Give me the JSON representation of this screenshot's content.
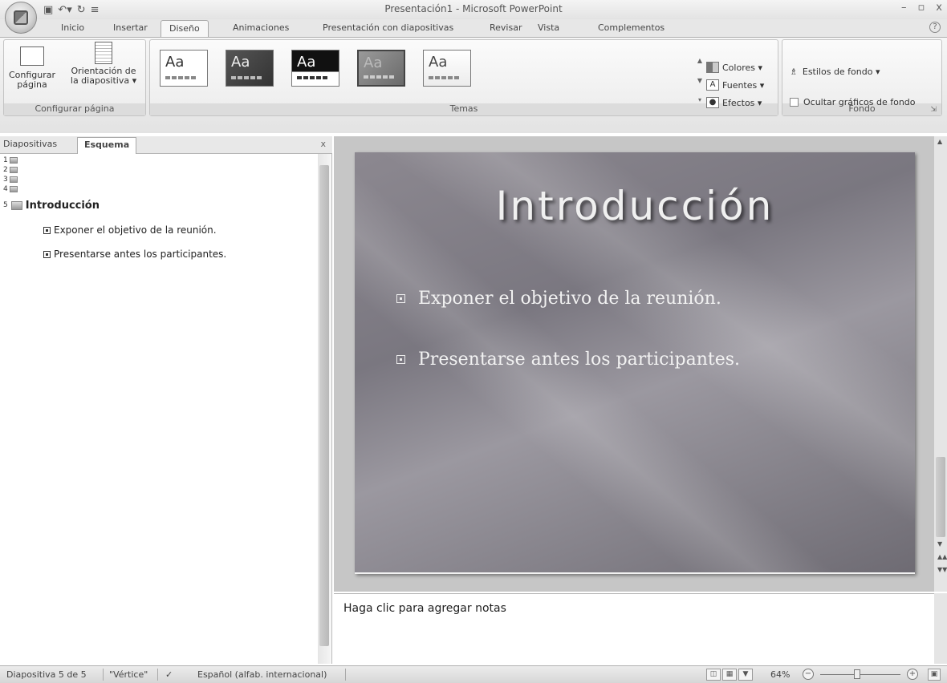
{
  "window": {
    "title": "Presentación1 - Microsoft PowerPoint",
    "controls": [
      "–",
      "▫",
      "x"
    ]
  },
  "quick_access": {
    "save_icon": "floppy-disk-icon",
    "undo_icon": "undo-icon",
    "redo_icon": "redo-icon",
    "customize_icon": "customize-qat-icon"
  },
  "tabs": [
    "Inicio",
    "Insertar",
    "Diseño",
    "Animaciones",
    "Presentación con diapositivas",
    "Revisar",
    "Vista",
    "Complementos"
  ],
  "active_tab": "Diseño",
  "ribbon": {
    "page_setup": {
      "configurar_line1": "Configurar",
      "configurar_line2": "página",
      "orientacion_line1": "Orientación de",
      "orientacion_line2": "la diapositiva ▾",
      "group_label": "Configurar página"
    },
    "themes": {
      "sample": "Aa",
      "group_label": "Temas",
      "colores": "Colores ▾",
      "fuentes": "Fuentes ▾",
      "efectos": "Efectos ▾"
    },
    "background": {
      "estilos": "Estilos de fondo ▾",
      "ocultar": "Ocultar gráficos de fondo",
      "group_label": "Fondo"
    }
  },
  "left_pane": {
    "tab_slides": "Diapositivas",
    "tab_outline": "Esquema",
    "close": "x",
    "outline_numbers": [
      "1",
      "2",
      "3",
      "4"
    ],
    "slide5_number": "5",
    "slide5_title": "Introducción",
    "slide5_bullets": [
      "Exponer el objetivo de la reunión.",
      "Presentarse antes los participantes."
    ]
  },
  "slide": {
    "title": "Introducción",
    "bullets": [
      "Exponer el objetivo de la reunión.",
      "Presentarse antes los participantes."
    ]
  },
  "notes": {
    "placeholder": "Haga clic para agregar notas"
  },
  "status_bar": {
    "slide_info": "Diapositiva 5 de 5",
    "theme_name": "\"Vértice\"",
    "language": "Español (alfab. internacional)",
    "zoom": "64%"
  }
}
